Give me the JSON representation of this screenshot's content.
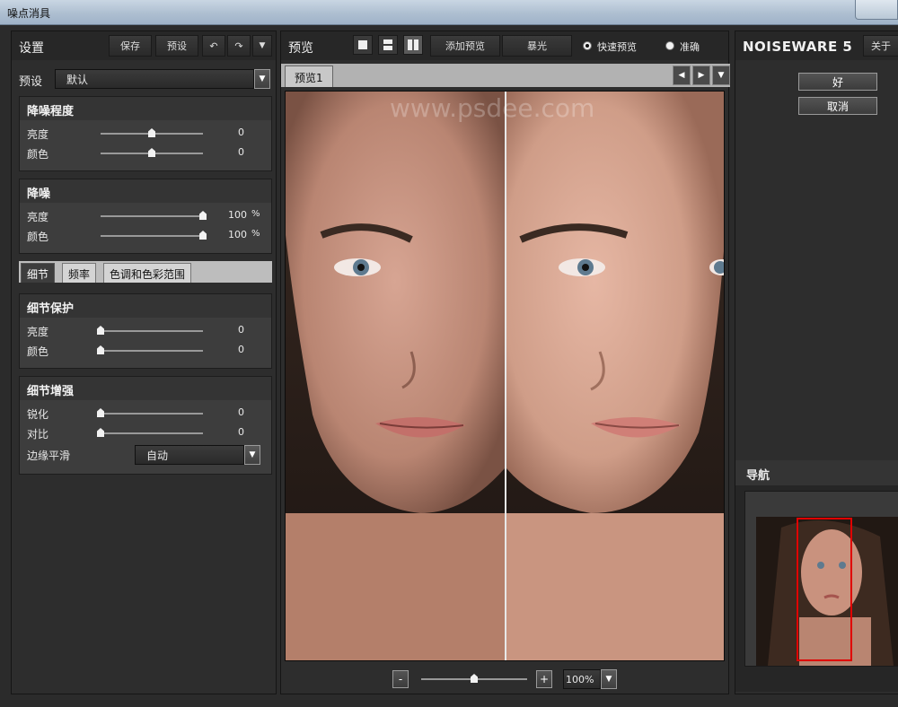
{
  "window": {
    "title": "噪点消具"
  },
  "left": {
    "header": "设置",
    "save_label": "保存",
    "preset_label": "预设",
    "undo_icon": "undo-icon",
    "redo_icon": "redo-icon",
    "preset_row": {
      "label": "预设",
      "value": "默认"
    },
    "noise_level": {
      "title": "降噪程度",
      "rows": [
        {
          "label": "亮度",
          "value": "0",
          "level": 0.5
        },
        {
          "label": "颜色",
          "value": "0",
          "level": 0.5
        }
      ]
    },
    "noise_reduction": {
      "title": "降噪",
      "rows": [
        {
          "label": "亮度",
          "value": "100",
          "unit": "%",
          "level": 1.0
        },
        {
          "label": "颜色",
          "value": "100",
          "unit": "%",
          "level": 1.0
        }
      ]
    },
    "tabs": [
      "细节",
      "频率",
      "色调和色彩范围"
    ],
    "detail_protect": {
      "title": "细节保护",
      "rows": [
        {
          "label": "亮度",
          "value": "0",
          "level": 0.0
        },
        {
          "label": "颜色",
          "value": "0",
          "level": 0.0
        }
      ]
    },
    "detail_enhance": {
      "title": "细节增强",
      "rows": [
        {
          "label": "锐化",
          "value": "0",
          "level": 0.0
        },
        {
          "label": "对比",
          "value": "0",
          "level": 0.0
        }
      ],
      "edge_smooth": {
        "label": "边缘平滑",
        "value": "自动"
      }
    }
  },
  "center": {
    "header": "预览",
    "add_preview": "添加预览",
    "exposure": "暴光",
    "fast_preview": "快速预览",
    "accurate": "准确",
    "preview_tab": "预览1",
    "watermark": "www.psdee.com",
    "zoom": {
      "minus": "-",
      "plus": "+",
      "value": "100%",
      "level": 0.5
    }
  },
  "right": {
    "brand": "NOISEWARE 5",
    "about": "关于",
    "ok": "好",
    "cancel": "取消",
    "navigator": "导航"
  },
  "colors": {
    "accent_red": "#e00000"
  }
}
